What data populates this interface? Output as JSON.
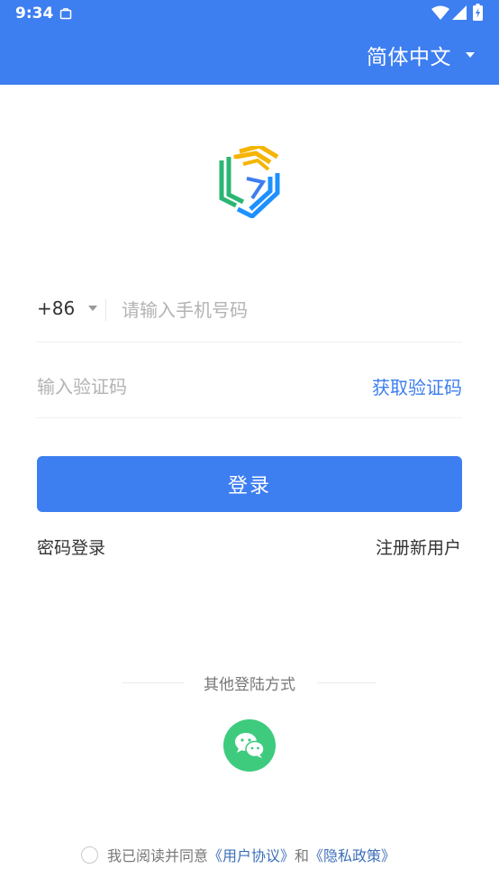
{
  "status_bar": {
    "time": "9:34",
    "icons": [
      "notification-clipboard-icon",
      "wifi-icon",
      "signal-icon",
      "battery-charging-icon"
    ]
  },
  "header": {
    "language_label": "简体中文",
    "language_icon": "caret-down-icon"
  },
  "logo": {
    "icon": "app-logo",
    "colors": [
      "#3d7ef0",
      "#2bb673",
      "#f5b400",
      "#1e90ff"
    ]
  },
  "form": {
    "country_code": "+86",
    "phone_placeholder": "请输入手机号码",
    "code_placeholder": "输入验证码",
    "get_code_label": "获取验证码",
    "login_label": "登录"
  },
  "links": {
    "password_login": "密码登录",
    "register": "注册新用户"
  },
  "other_login": {
    "title": "其他登陆方式",
    "wechat_icon": "wechat-icon",
    "wechat_color": "#3ecb7e"
  },
  "agreement": {
    "prefix": "我已阅读并同意",
    "user_agreement": "《用户协议》",
    "and": "和",
    "privacy_policy": "《隐私政策》"
  },
  "colors": {
    "primary": "#3d7ef0",
    "link": "#3d6fb8"
  }
}
